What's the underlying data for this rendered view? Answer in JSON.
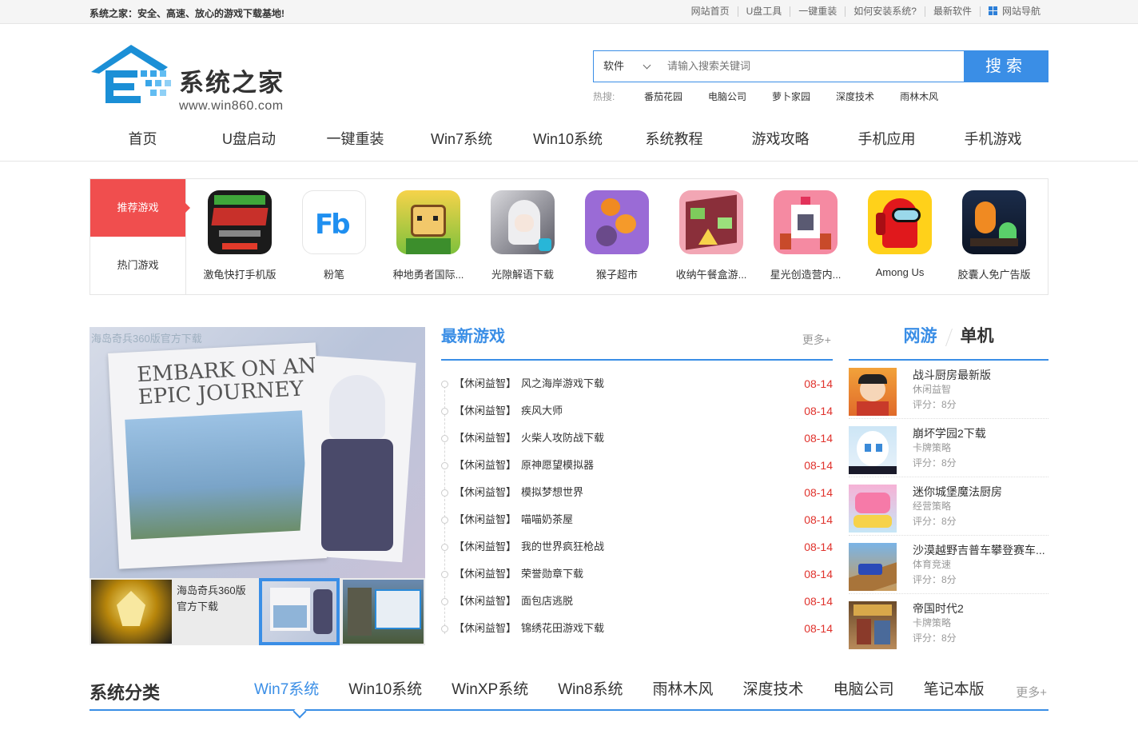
{
  "topbar": {
    "slogan": "系统之家：安全、高速、放心的游戏下载基地!",
    "links": [
      "网站首页",
      "U盘工具",
      "一键重装",
      "如何安装系统?",
      "最新软件"
    ],
    "site_nav": "网站导航"
  },
  "logo": {
    "name": "系统之家",
    "url": "www.win860.com"
  },
  "search": {
    "category": "软件",
    "placeholder": "请输入搜索关键词",
    "button": "搜索",
    "hot_label": "热搜:",
    "hot": [
      "番茄花园",
      "电脑公司",
      "萝卜家园",
      "深度技术",
      "雨林木风"
    ]
  },
  "nav": [
    "首页",
    "U盘启动",
    "一键重装",
    "Win7系统",
    "Win10系统",
    "系统教程",
    "游戏攻略",
    "手机应用",
    "手机游戏"
  ],
  "recommend": {
    "tabs": [
      "推荐游戏",
      "热门游戏"
    ],
    "games": [
      {
        "name": "激龟快打手机版",
        "icon": "turtles-game-icon"
      },
      {
        "name": "粉笔",
        "icon": "fenbi-app-icon"
      },
      {
        "name": "种地勇者国际...",
        "icon": "farm-hero-icon"
      },
      {
        "name": "光隙解语下载",
        "icon": "anime-girl-icon"
      },
      {
        "name": "猴子超市",
        "icon": "pumpkin-monkey-icon"
      },
      {
        "name": "收纳午餐盒游...",
        "icon": "lunchbox-icon"
      },
      {
        "name": "星光创造营内...",
        "icon": "pixel-star-icon"
      },
      {
        "name": "Among Us",
        "icon": "among-us-icon"
      },
      {
        "name": "胶囊人免广告版",
        "icon": "capsule-man-icon"
      }
    ]
  },
  "slider": {
    "main_alt": "海岛奇兵360版官方下载",
    "main_banner": "EMBARK ON AN EPIC JOURNEY",
    "thumb_alt": "海岛奇兵360版官方下载"
  },
  "latest": {
    "title": "最新游戏",
    "more": "更多+",
    "items": [
      {
        "cat": "【休闲益智】",
        "title": "风之海岸游戏下载",
        "date": "08-14"
      },
      {
        "cat": "【休闲益智】",
        "title": "疾风大师",
        "date": "08-14"
      },
      {
        "cat": "【休闲益智】",
        "title": "火柴人攻防战下载",
        "date": "08-14"
      },
      {
        "cat": "【休闲益智】",
        "title": "原神愿望模拟器",
        "date": "08-14"
      },
      {
        "cat": "【休闲益智】",
        "title": "模拟梦想世界",
        "date": "08-14"
      },
      {
        "cat": "【休闲益智】",
        "title": "喵喵奶茶屋",
        "date": "08-14"
      },
      {
        "cat": "【休闲益智】",
        "title": "我的世界疯狂枪战",
        "date": "08-14"
      },
      {
        "cat": "【休闲益智】",
        "title": "荣誉勋章下载",
        "date": "08-14"
      },
      {
        "cat": "【休闲益智】",
        "title": "面包店逃脱",
        "date": "08-14"
      },
      {
        "cat": "【休闲益智】",
        "title": "锦绣花田游戏下载",
        "date": "08-14"
      }
    ]
  },
  "rank": {
    "tabs": [
      "网游",
      "单机"
    ],
    "items": [
      {
        "name": "战斗厨房最新版",
        "cat": "休闲益智",
        "score": "评分：8分"
      },
      {
        "name": "崩坏学园2下载",
        "cat": "卡牌策略",
        "score": "评分：8分"
      },
      {
        "name": "迷你城堡魔法厨房",
        "cat": "经营策略",
        "score": "评分：8分"
      },
      {
        "name": "沙漠越野吉普车攀登赛车...",
        "cat": "体育竞速",
        "score": "评分：8分"
      },
      {
        "name": "帝国时代2",
        "cat": "卡牌策略",
        "score": "评分：8分"
      }
    ]
  },
  "system": {
    "title": "系统分类",
    "tabs": [
      "Win7系统",
      "Win10系统",
      "WinXP系统",
      "Win8系统",
      "雨林木风",
      "深度技术",
      "电脑公司",
      "笔记本版"
    ],
    "more": "更多+"
  },
  "colors": {
    "accent": "#3a8ee6",
    "red": "#f04e4e",
    "date": "#e0322c"
  }
}
